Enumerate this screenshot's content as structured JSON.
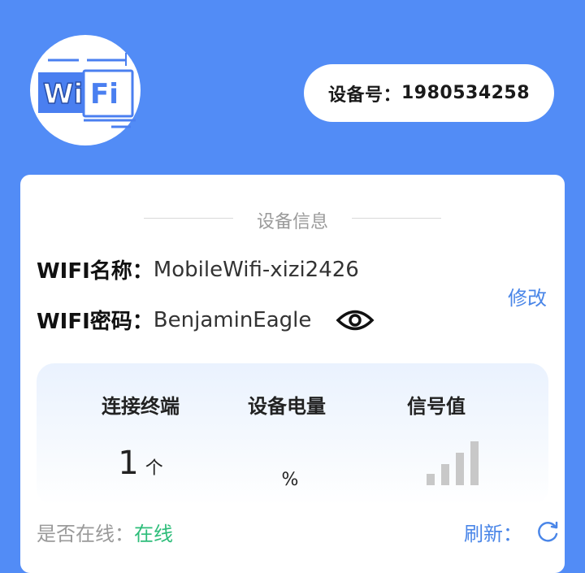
{
  "logo": {
    "text_left": "Wi",
    "text_right": "Fi",
    "accent": "#4a7ff0",
    "icon": "wifi-logo-icon"
  },
  "device": {
    "label": "设备号：",
    "number": "1980534258"
  },
  "card": {
    "section_title": "设备信息",
    "wifi_name_label": "WIFI名称：",
    "wifi_name_value": "MobileWifi-xizi2426",
    "wifi_pwd_label": "WIFI密码：",
    "wifi_pwd_value": "BenjaminEagle",
    "modify_label": "修改",
    "eye_icon": "eye-icon"
  },
  "stats": {
    "headers": [
      "连接终端",
      "设备电量",
      "信号值"
    ],
    "connected_count": "1",
    "connected_unit": "个",
    "battery_value": "",
    "battery_unit": "%",
    "signal_bars_total": 4,
    "signal_bars_active": 0,
    "signal_bar_color": "#c8c8c8"
  },
  "status": {
    "online_label": "是否在线：",
    "online_value": "在线",
    "online_color": "#2ebd7a",
    "refresh_label": "刷新：",
    "refresh_icon": "refresh-icon"
  },
  "colors": {
    "background": "#528cf6",
    "link": "#4a86e8"
  }
}
